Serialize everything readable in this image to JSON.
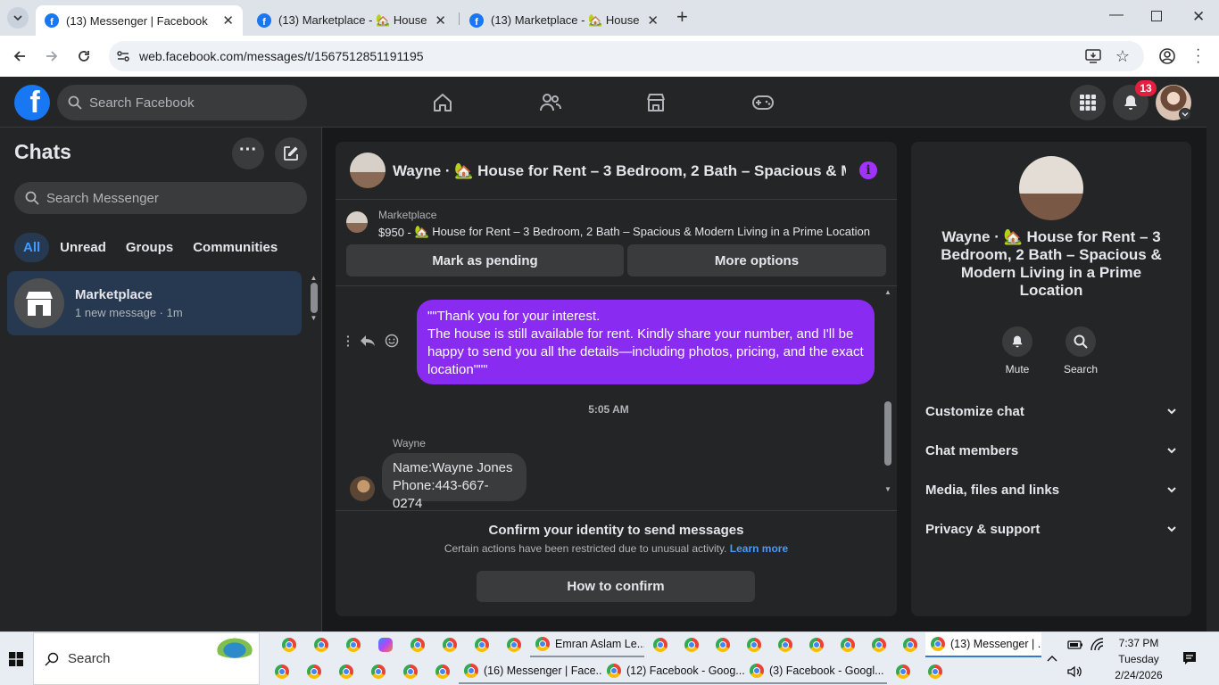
{
  "browser": {
    "tabs": [
      {
        "title": "(13) Messenger | Facebook",
        "active": true
      },
      {
        "title": "(13) Marketplace - 🏡 House fo",
        "active": false
      },
      {
        "title": "(13) Marketplace - 🏡 House fo",
        "active": false
      }
    ],
    "new_tab": "+",
    "url": "web.facebook.com/messages/t/1567512851191195"
  },
  "fb_header": {
    "logo": "f",
    "search_placeholder": "Search Facebook",
    "notification_count": "13"
  },
  "sidebar": {
    "title": "Chats",
    "search_placeholder": "Search Messenger",
    "filters": [
      "All",
      "Unread",
      "Groups",
      "Communities"
    ],
    "chats": [
      {
        "name": "Marketplace",
        "preview": "1 new message · 1m"
      }
    ]
  },
  "conversation": {
    "title": "Wayne · 🏡 House for Rent – 3 Bedroom, 2 Bath – Spacious & M…",
    "listing_source": "Marketplace",
    "listing_price": "$950 -",
    "listing_title": "🏡 House for Rent – 3 Bedroom, 2 Bath – Spacious & Modern Living in a Prime Location",
    "mark_pending": "Mark as pending",
    "more_options": "More options",
    "sent_message": "\"\"Thank you for your interest.\nThe house is still available for rent. Kindly share your number, and I'll be happy to send you all the details—including photos, pricing, and the exact location\"\"\"",
    "timestamp": "5:05 AM",
    "sender_name": "Wayne",
    "received_line1": "Name:Wayne Jones",
    "received_line2": "Phone:443-667-0274",
    "restrict_title": "Confirm your identity to send messages",
    "restrict_text": "Certain actions have been restricted due to unusual activity.",
    "learn_more": "Learn more",
    "confirm_button": "How to confirm"
  },
  "info_panel": {
    "title": "Wayne · 🏡 House for Rent – 3 Bedroom, 2 Bath – Spacious & Modern Living in a Prime Location",
    "mute": "Mute",
    "search": "Search",
    "sections": [
      "Customize chat",
      "Chat members",
      "Media, files and links",
      "Privacy & support"
    ]
  },
  "taskbar": {
    "search": "Search",
    "row1_items": [
      "Emran Aslam Le...",
      "(13) Messenger | ..."
    ],
    "row2_items": [
      "(16) Messenger | Face...",
      "(12) Facebook - Goog...",
      "(3) Facebook - Googl..."
    ],
    "time": "7:37 PM",
    "day": "Tuesday",
    "date": "2/24/2026"
  },
  "colors": {
    "accent": "#1877f2",
    "bubble": "#8a2bf2",
    "badge": "#e41e3f",
    "info_icon": "#a033ff"
  }
}
